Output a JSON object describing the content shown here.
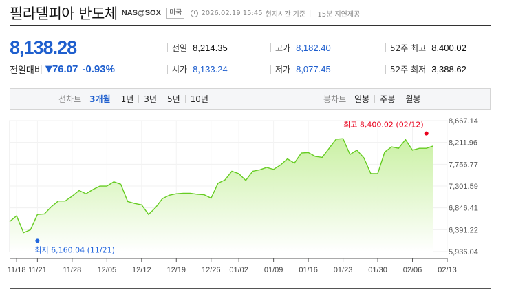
{
  "header": {
    "title": "필라델피아 반도체",
    "code": "NAS@SOX",
    "market": "미국",
    "datetime": "2026.02.19 15:45",
    "timezone": "현지시간 기준",
    "delay": "15분 지연제공"
  },
  "quote": {
    "price": "8,138.28",
    "change_label": "전일대비",
    "change": "76.07",
    "change_pct": "-0.93%",
    "direction": "down"
  },
  "stats": [
    {
      "label": "전일",
      "value": "8,214.35",
      "color": "#111111"
    },
    {
      "label": "고가",
      "value": "8,182.40",
      "color": "#1f5fce"
    },
    {
      "label": "52주 최고",
      "value": "8,400.02",
      "color": "#111111"
    },
    {
      "label": "시가",
      "value": "8,133.24",
      "color": "#1f5fce"
    },
    {
      "label": "저가",
      "value": "8,077.45",
      "color": "#1f5fce"
    },
    {
      "label": "52주 최저",
      "value": "3,388.62",
      "color": "#111111"
    }
  ],
  "toolbar": {
    "line_label": "선차트",
    "periods": [
      "3개월",
      "1년",
      "3년",
      "5년",
      "10년"
    ],
    "active_period": "3개월",
    "candle_label": "봉차트",
    "candles": [
      "일봉",
      "주봉",
      "월봉"
    ]
  },
  "colors": {
    "accent": "#1f5fce",
    "line": "#66cc22",
    "fill_top": "#c8f0a0",
    "max_marker": "#e8001c",
    "min_marker": "#2266dd"
  },
  "chart_data": {
    "type": "area",
    "title": "",
    "xlabel": "",
    "ylabel": "",
    "ylim": [
      5936.04,
      8667.14
    ],
    "y_ticks": [
      5936.04,
      6391.22,
      6846.41,
      7301.59,
      7756.77,
      8211.96,
      8667.14
    ],
    "y_tick_labels": [
      "5,936.04",
      "6,391.22",
      "6,846.41",
      "7,301.59",
      "7,756.77",
      "8,211.96",
      "8,667.14"
    ],
    "x_tick_labels": [
      "11/18",
      "11/21",
      "11/28",
      "12/05",
      "12/12",
      "12/19",
      "12/26",
      "01/02",
      "01/09",
      "01/16",
      "01/23",
      "01/30",
      "02/06",
      "02/13"
    ],
    "x_tick_positions": [
      1,
      4,
      9,
      14,
      19,
      24,
      29,
      33,
      38,
      43,
      48,
      53,
      58,
      63
    ],
    "x_count": 64,
    "values": [
      6560,
      6680,
      6330,
      6390,
      6710,
      6720,
      6870,
      6990,
      6990,
      7090,
      7210,
      7140,
      7230,
      7300,
      7300,
      7390,
      7340,
      6980,
      6940,
      6910,
      6710,
      6850,
      7040,
      7110,
      7140,
      7150,
      7150,
      7130,
      7120,
      7050,
      7360,
      7430,
      7610,
      7560,
      7420,
      7610,
      7640,
      7690,
      7650,
      7740,
      7870,
      7780,
      7990,
      8000,
      7920,
      7900,
      8090,
      8280,
      8290,
      7960,
      8050,
      7890,
      7560,
      7560,
      8010,
      8120,
      8090,
      8270,
      8050,
      8090,
      8090,
      8138
    ],
    "max_point": {
      "label": "최고 8,400.02 (02/12)",
      "index": 60,
      "value": 8400.02
    },
    "min_point": {
      "label": "최저 6,160.04 (11/21)",
      "index": 4,
      "value": 6160.04
    },
    "grid": true
  }
}
